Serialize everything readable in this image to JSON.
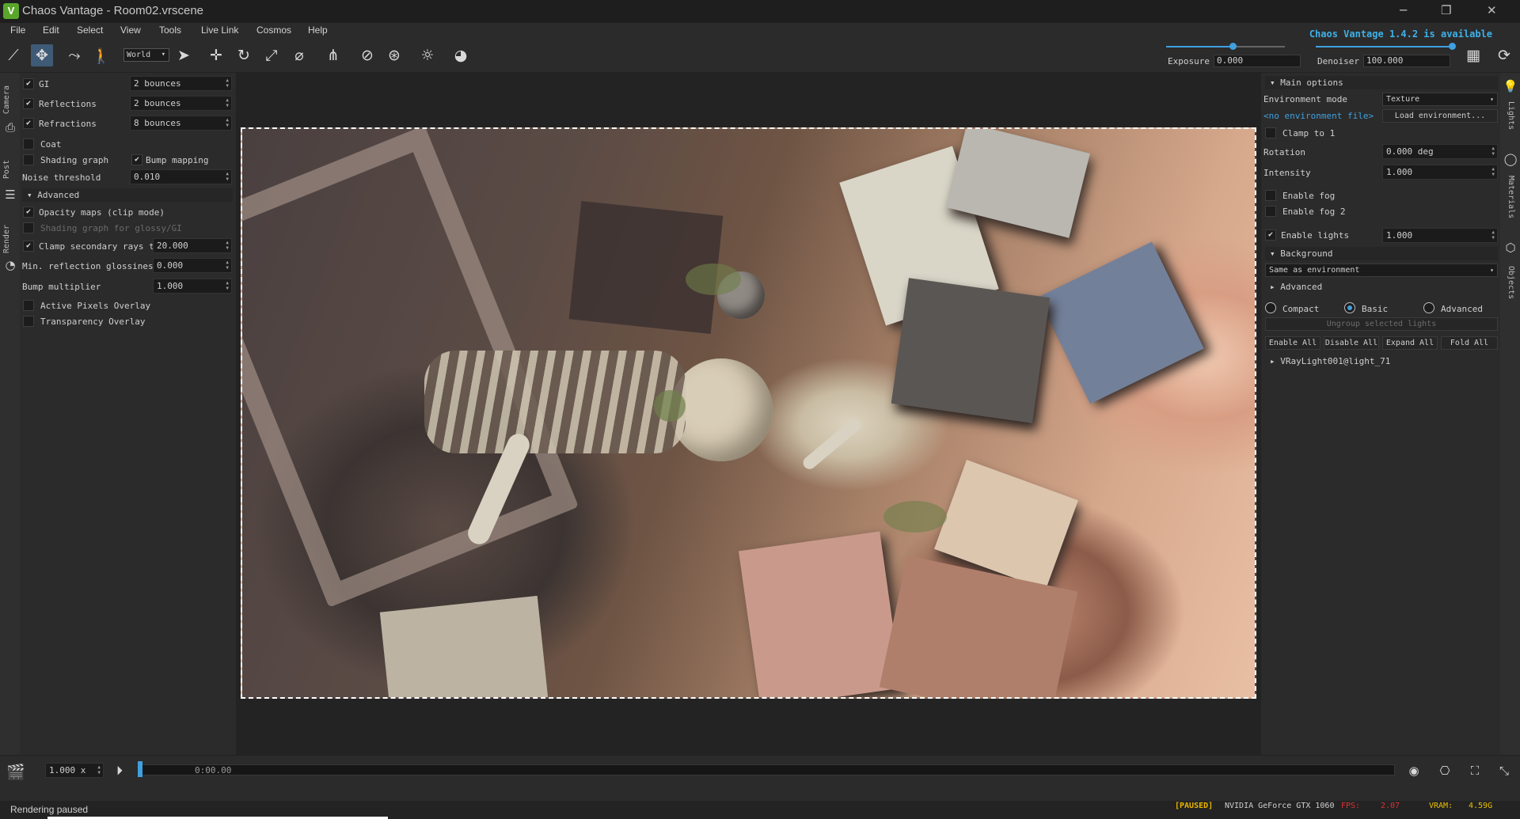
{
  "window": {
    "title": "Chaos Vantage - Room02.vrscene",
    "update_notice": "Chaos Vantage 1.4.2 is available",
    "logo_letter": "V"
  },
  "menu": [
    "File",
    "Edit",
    "Select",
    "View",
    "Tools",
    "Live Link",
    "Cosmos",
    "Help"
  ],
  "toolbar": {
    "space": "World",
    "exposure_label": "Exposure",
    "exposure_value": "0.000",
    "denoiser_label": "Denoiser",
    "denoiser_value": "100.000",
    "exposure_fraction": 0.55,
    "denoiser_fraction": 1.0
  },
  "left_tabs": [
    "Camera",
    "Post",
    "Render"
  ],
  "right_tabs": [
    "Lights",
    "Materials",
    "Objects"
  ],
  "render_settings": {
    "gi_label": "GI",
    "gi_value": "2 bounces",
    "reflections_label": "Reflections",
    "reflections_value": "2 bounces",
    "refractions_label": "Refractions",
    "refractions_value": "8 bounces",
    "coat_label": "Coat",
    "shading_graph_label": "Shading graph",
    "bump_mapping_label": "Bump mapping",
    "noise_threshold_label": "Noise threshold",
    "noise_threshold_value": "0.010",
    "advanced_label": "Advanced",
    "opacity_maps_label": "Opacity maps (clip mode)",
    "shading_graph_glossy_label": "Shading graph for glossy/GI",
    "clamp_secondary_label": "Clamp secondary rays to",
    "clamp_secondary_value": "20.000",
    "min_refl_gloss_label": "Min. reflection glossiness",
    "min_refl_gloss_value": "0.000",
    "bump_multiplier_label": "Bump multiplier",
    "bump_multiplier_value": "1.000",
    "active_pixels_label": "Active Pixels Overlay",
    "transparency_overlay_label": "Transparency Overlay"
  },
  "lights_panel": {
    "main_options_label": "Main options",
    "env_mode_label": "Environment mode",
    "env_mode_value": "Texture",
    "env_file_link": "<no environment file>",
    "load_env_button": "Load environment...",
    "clamp_label": "Clamp to 1",
    "rotation_label": "Rotation",
    "rotation_value": "0.000 deg",
    "intensity_label": "Intensity",
    "intensity_value": "1.000",
    "enable_fog_label": "Enable fog",
    "enable_fog2_label": "Enable fog 2",
    "enable_lights_label": "Enable lights",
    "enable_lights_value": "1.000",
    "background_label": "Background",
    "background_value": "Same as environment",
    "advanced_label": "Advanced",
    "view_compact": "Compact",
    "view_basic": "Basic",
    "view_advanced": "Advanced",
    "ungroup_button": "Ungroup selected lights",
    "enable_all_button": "Enable All",
    "disable_all_button": "Disable All",
    "expand_all_button": "Expand All",
    "fold_all_button": "Fold All",
    "light_item": "VRayLight001@light_71"
  },
  "timeline": {
    "speed": "1.000 x",
    "time": "0:00.00"
  },
  "status": {
    "text": "Rendering paused",
    "paused": "[PAUSED]",
    "gpu": "NVIDIA GeForce GTX 1060",
    "fps_label": "FPS:",
    "fps_value": "2.07",
    "vram_label": "VRAM:",
    "vram_value": "4.59G"
  },
  "colors": {
    "accent": "#3fa0e0",
    "paused": "#e8b400",
    "fps": "#e03030",
    "vram": "#e8c000",
    "logo": "#5aa62c"
  }
}
